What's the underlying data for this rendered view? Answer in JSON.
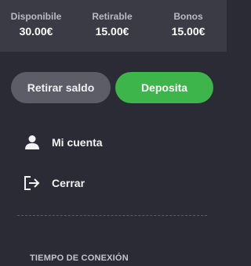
{
  "balances": {
    "available": {
      "label": "Disponibile",
      "value": "30.00€"
    },
    "withdrawable": {
      "label": "Retirable",
      "value": "15.00€"
    },
    "bonus": {
      "label": "Bonos",
      "value": "15.00€"
    }
  },
  "actions": {
    "withdraw_label": "Retirar saldo",
    "deposit_label": "Deposita"
  },
  "menu": {
    "account": {
      "label": "Mi cuenta",
      "icon": "user-icon"
    },
    "logout": {
      "label": "Cerrar",
      "icon": "logout-icon"
    }
  },
  "section": {
    "connection_time_title": "TIEMPO DE CONEXIÓN"
  },
  "colors": {
    "background": "#2a2b35",
    "balance_bar": "#3a3b45",
    "deposit_green": "#3db54a",
    "withdraw_gray": "#5c5d67"
  }
}
